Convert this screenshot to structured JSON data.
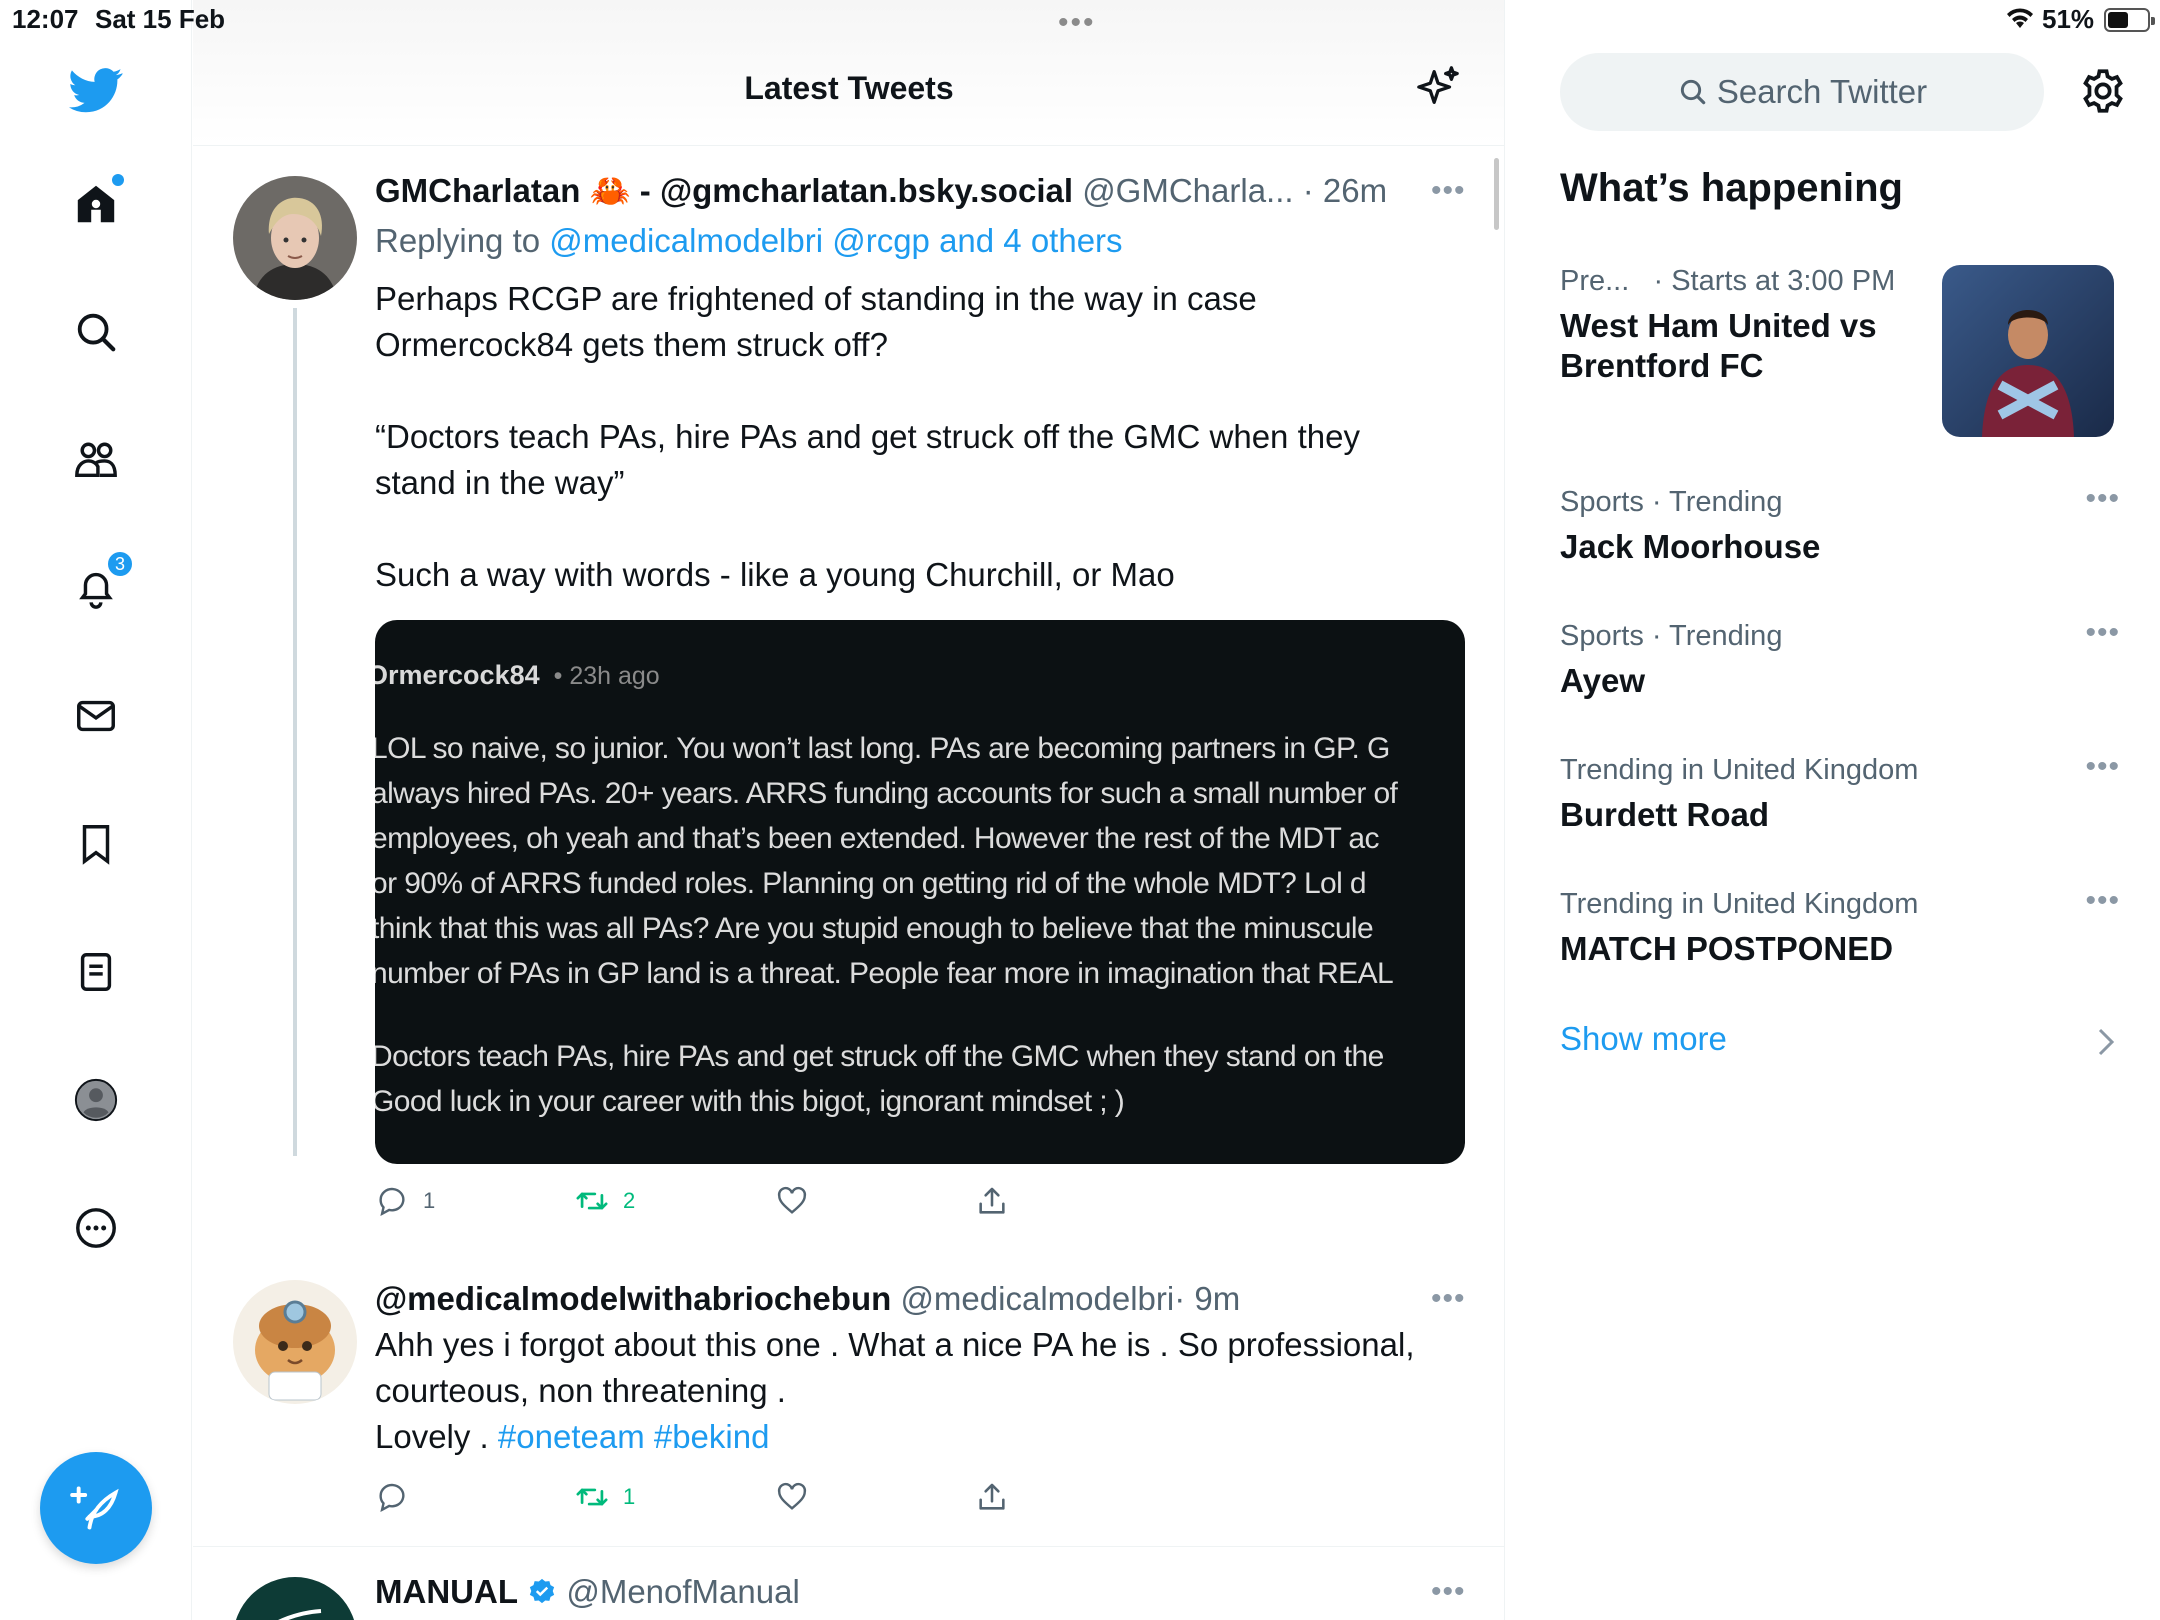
{
  "status_bar": {
    "time": "12:07",
    "date": "Sat 15 Feb",
    "battery": "51%",
    "battery_level": 0.51
  },
  "nav": {
    "notifications_count": "3"
  },
  "header": {
    "title": "Latest Tweets"
  },
  "tweets": [
    {
      "name": "GMCharlatan 🦀 - @gmcharlatan.bsky.social",
      "handle": "@GMCharla...",
      "time": "· 26m",
      "reply_prefix": "Replying to",
      "reply_to": "@medicalmodelbri @rcgp and 4 others",
      "text": "Perhaps RCGP are frightened of standing in the way in case\nOrmercock84 gets them struck off?\n\n“Doctors teach PAs, hire PAs and get struck off the GMC when they\nstand in the way”\n\nSuch a way with words - like a young Churchill, or Mao",
      "replies": "1",
      "retweets": "2",
      "media": {
        "user": "Ormercock84",
        "ago": "• 23h ago",
        "lines": [
          "LOL so naive, so junior. You won’t last long. PAs are becoming partners in GP. G",
          "always hired PAs. 20+ years. ARRS funding accounts for such a small number of",
          "employees, oh yeah and that’s been extended. However the rest of the MDT ac",
          "or 90% of ARRS funded roles. Planning on getting rid of the whole MDT? Lol d",
          "think that this was all PAs? Are you stupid enough to believe that the minuscule",
          "number of PAs in GP land is a threat. People fear more in imagination that REAL",
          "Doctors teach PAs, hire PAs and get struck off the GMC when they stand on the",
          "Good luck in your career with this bigot, ignorant mindset ; )"
        ]
      }
    },
    {
      "name": "@medicalmodelwithabriochebun",
      "handle": "@medicalmodelbri",
      "time": "· 9m",
      "text_plain": "Ahh yes i forgot about this one . What a nice PA he is . So professional,\ncourteous, non threatening .\nLovely . ",
      "hashtags": "#oneteam #bekind",
      "replies": "",
      "retweets": "1"
    },
    {
      "name": "MANUAL",
      "handle": "@MenofManual"
    }
  ],
  "right": {
    "search_placeholder": "Search Twitter",
    "section_title": "What’s happening",
    "event": {
      "category": "Pre...",
      "time": "· Starts at 3:00 PM",
      "name": "West Ham United vs Brentford FC"
    },
    "trends": [
      {
        "meta": "Sports · Trending",
        "name": "Jack Moorhouse"
      },
      {
        "meta": "Sports · Trending",
        "name": "Ayew"
      },
      {
        "meta": "Trending in United Kingdom",
        "name": "Burdett Road"
      },
      {
        "meta": "Trending in United Kingdom",
        "name": "MATCH POSTPONED"
      }
    ],
    "show_more": "Show more"
  },
  "colors": {
    "accent": "#1d9bf0",
    "retweet": "#00ba7c",
    "secondary_text": "#536471"
  }
}
